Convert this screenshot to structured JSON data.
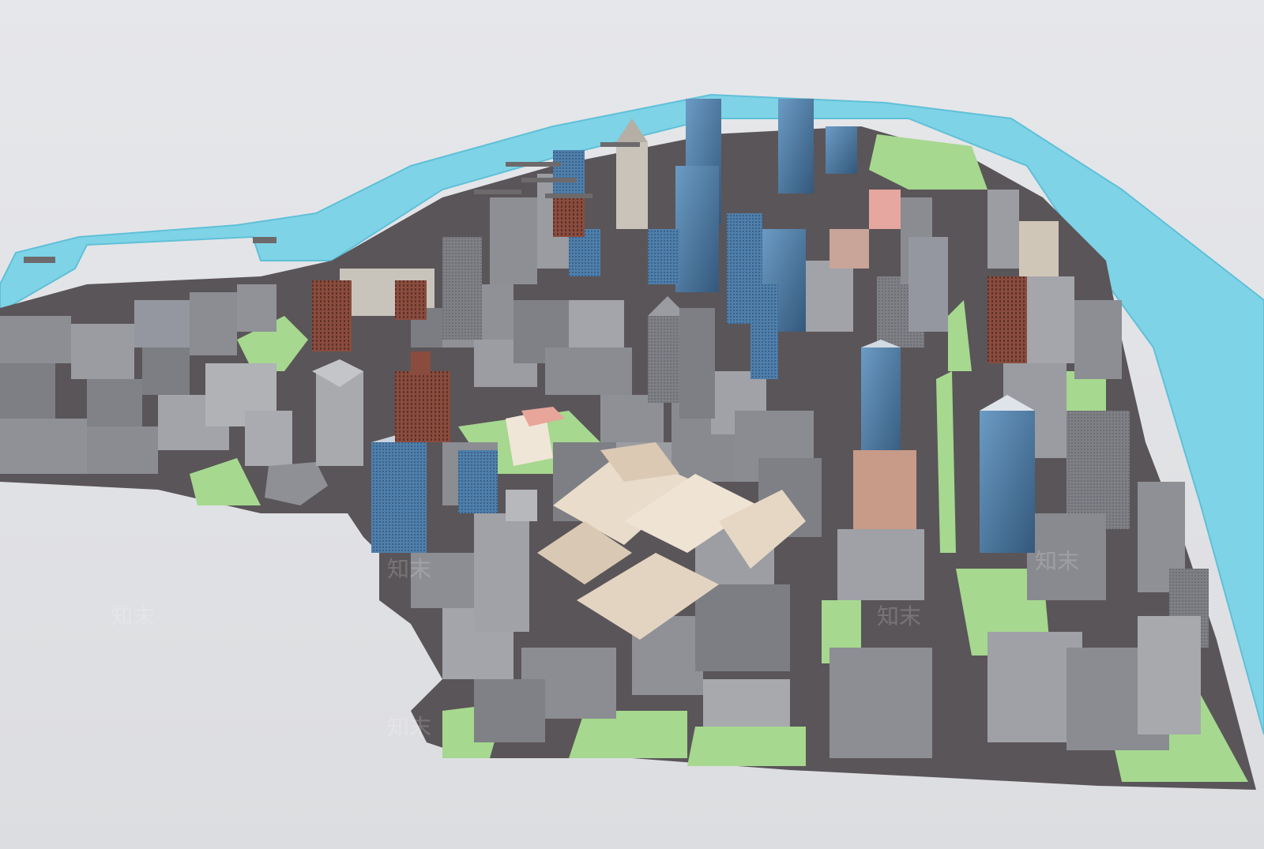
{
  "watermark": {
    "text": "知末"
  },
  "colors": {
    "sky": "#e9eaec",
    "ground": "#dfe0e3",
    "water": "#7fd3e6",
    "water_edge": "#5fc0d8",
    "street": "#5a5558",
    "park": "#a6d88f",
    "building_gray": "#8c8e93",
    "building_light": "#b7b8bc",
    "tower_blue": "#4d7ca6",
    "brick": "#8a4c3e",
    "cream": "#e9dccb",
    "pink": "#e8a59a"
  }
}
